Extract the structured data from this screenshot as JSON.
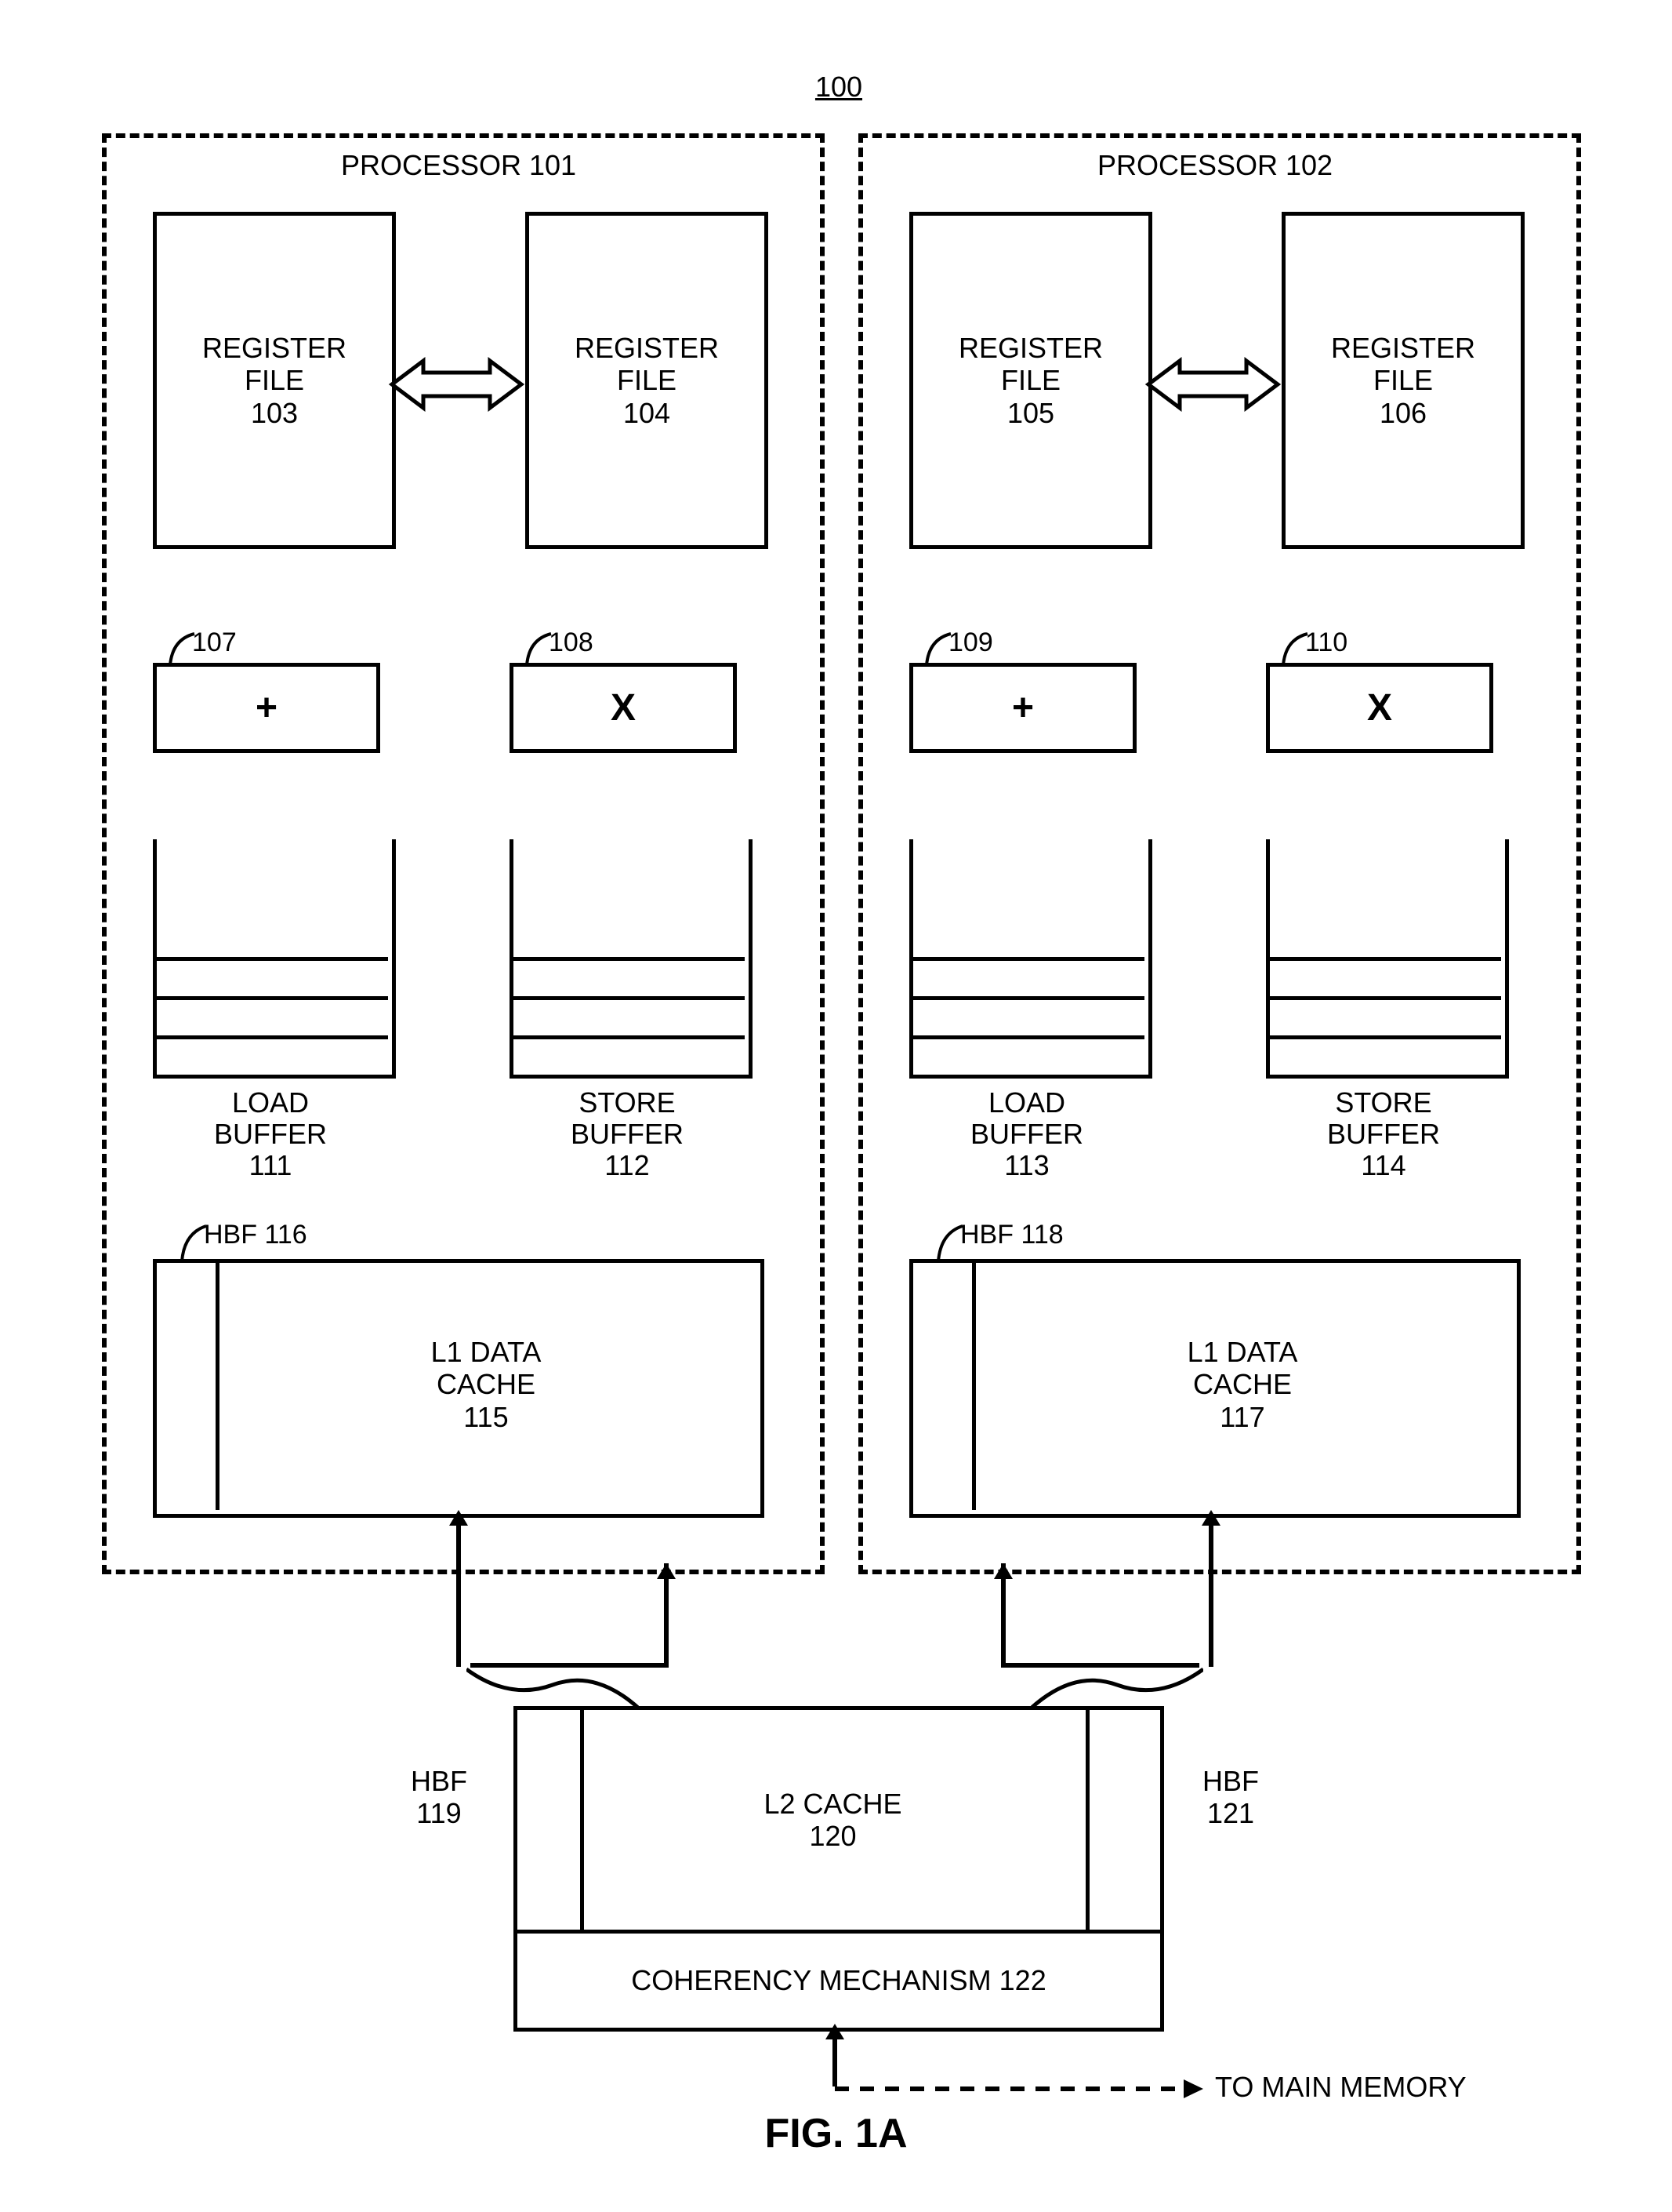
{
  "figure_ref": "100",
  "figure_label": "FIG. 1A",
  "processors": [
    {
      "title": "PROCESSOR  101",
      "regfile_left": {
        "line1": "REGISTER",
        "line2": "FILE",
        "ref": "103"
      },
      "regfile_right": {
        "line1": "REGISTER",
        "line2": "FILE",
        "ref": "104"
      },
      "adder": {
        "ref": "107",
        "glyph": "+"
      },
      "mult": {
        "ref": "108",
        "glyph": "X"
      },
      "load_buffer": {
        "line1": "LOAD",
        "line2": "BUFFER",
        "ref": "111"
      },
      "store_buffer": {
        "line1": "STORE",
        "line2": "BUFFER",
        "ref": "112"
      },
      "hbf": "HBF 116",
      "l1": {
        "line1": "L1 DATA",
        "line2": "CACHE",
        "ref": "115"
      }
    },
    {
      "title": "PROCESSOR  102",
      "regfile_left": {
        "line1": "REGISTER",
        "line2": "FILE",
        "ref": "105"
      },
      "regfile_right": {
        "line1": "REGISTER",
        "line2": "FILE",
        "ref": "106"
      },
      "adder": {
        "ref": "109",
        "glyph": "+"
      },
      "mult": {
        "ref": "110",
        "glyph": "X"
      },
      "load_buffer": {
        "line1": "LOAD",
        "line2": "BUFFER",
        "ref": "113"
      },
      "store_buffer": {
        "line1": "STORE",
        "line2": "BUFFER",
        "ref": "114"
      },
      "hbf": "HBF 118",
      "l1": {
        "line1": "L1 DATA",
        "line2": "CACHE",
        "ref": "117"
      }
    }
  ],
  "l2": {
    "left_hbf": {
      "line1": "HBF",
      "ref": "119"
    },
    "right_hbf": {
      "line1": "HBF",
      "ref": "121"
    },
    "label": {
      "line1": "L2 CACHE",
      "ref": "120"
    },
    "coherency": "COHERENCY MECHANISM 122",
    "to_main_memory": "TO MAIN MEMORY"
  }
}
